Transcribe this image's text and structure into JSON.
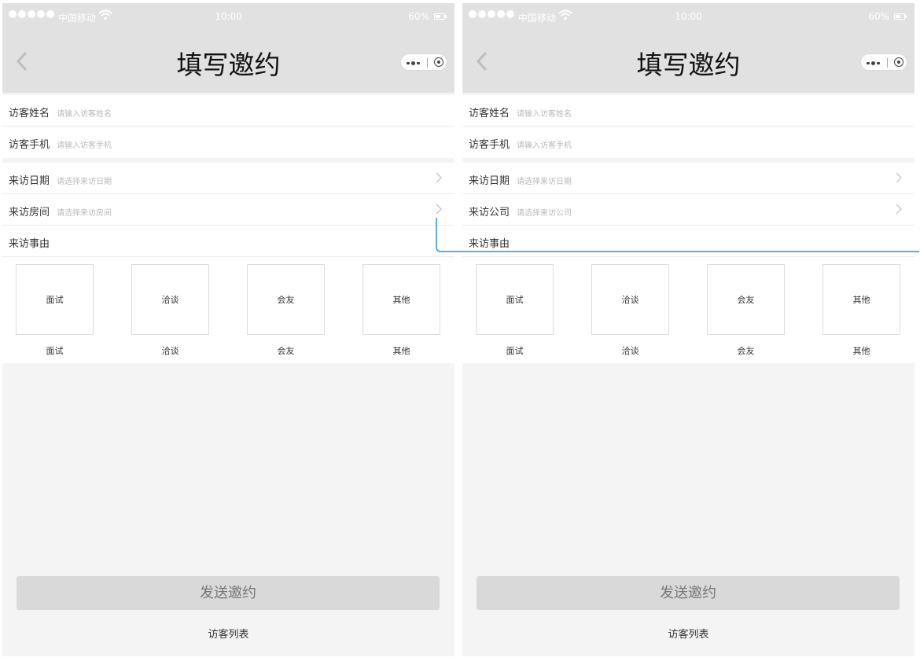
{
  "status_bar": {
    "carrier": "中国移动",
    "time": "10:00",
    "battery": "60%"
  },
  "nav": {
    "title": "填写邀约"
  },
  "phones": [
    {
      "rows_top": [
        {
          "label": "访客姓名",
          "placeholder": "请输入访客姓名"
        },
        {
          "label": "访客手机",
          "placeholder": "请输入访客手机"
        }
      ],
      "rows_select": [
        {
          "label": "来访日期",
          "placeholder": "请选择来访日期"
        },
        {
          "label": "来访房间",
          "placeholder": "请选择来访房间"
        }
      ],
      "reason_label": "来访事由",
      "reasons": [
        {
          "box": "面试",
          "caption": "面试"
        },
        {
          "box": "洽谈",
          "caption": "洽谈"
        },
        {
          "box": "会友",
          "caption": "会友"
        },
        {
          "box": "其他",
          "caption": "其他"
        }
      ],
      "send_label": "发送邀约",
      "list_link": "访客列表"
    },
    {
      "rows_top": [
        {
          "label": "访客姓名",
          "placeholder": "请输入访客姓名"
        },
        {
          "label": "访客手机",
          "placeholder": "请输入访客手机"
        }
      ],
      "rows_select": [
        {
          "label": "来访日期",
          "placeholder": "请选择来访日期"
        },
        {
          "label": "来访公司",
          "placeholder": "请选择来访公司"
        }
      ],
      "reason_label": "来访事由",
      "reasons": [
        {
          "box": "面试",
          "caption": "面试"
        },
        {
          "box": "洽谈",
          "caption": "洽谈"
        },
        {
          "box": "会友",
          "caption": "会友"
        },
        {
          "box": "其他",
          "caption": "其他"
        }
      ],
      "send_label": "发送邀约",
      "list_link": "访客列表"
    }
  ],
  "colors": {
    "nav_bg": "#e1e1e1",
    "page_bg": "#f4f4f4",
    "connector": "#2196d3"
  },
  "icons": {
    "back": "chevron-left-icon",
    "row_arrow": "chevron-right-icon",
    "wifi": "wifi-icon",
    "battery": "battery-icon",
    "menu": "more-dots-icon",
    "close": "close-circle-icon"
  }
}
